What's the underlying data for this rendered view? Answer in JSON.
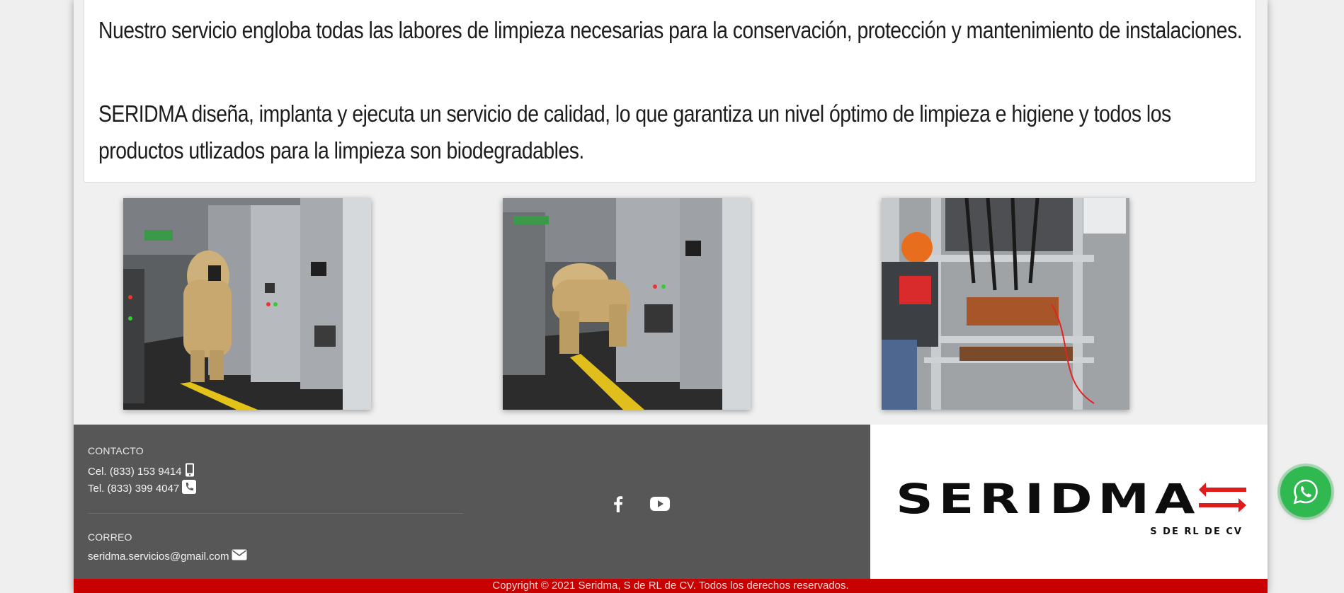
{
  "intro": {
    "paragraph1": "Nuestro servicio engloba todas las labores de limpieza necesarias para la conservación, protección y mantenimiento de instalaciones.",
    "paragraph2": "SERIDMA diseña, implanta y ejecuta un servicio de calidad, lo que garantiza un nivel óptimo de limpieza e higiene y todos los productos utlizados para la limpieza son biodegradables."
  },
  "gallery": [
    {
      "name": "gallery-photo-arc-flash-suit-1",
      "alt": ""
    },
    {
      "name": "gallery-photo-arc-flash-suit-2",
      "alt": ""
    },
    {
      "name": "gallery-photo-electrical-panel",
      "alt": ""
    }
  ],
  "footer": {
    "contact_heading": "CONTACTO",
    "cel": "Cel. (833) 153 9414",
    "cel_icon": "mobile-phone-icon",
    "tel": "Tel. (833) 399 4047",
    "tel_icon": "phone-icon",
    "email_heading": "CORREO",
    "email": "seridma.servicios@gmail.com",
    "email_icon": "envelope-icon",
    "social": [
      {
        "icon": "facebook-icon"
      },
      {
        "icon": "youtube-icon"
      }
    ],
    "logo_text": "SERIDMA",
    "logo_subtext": "S DE RL DE CV",
    "copyright": "Copyright © 2021 Seridma, S de RL de CV. Todos los derechos reservados."
  },
  "colors": {
    "footer_dark": "#575757",
    "copyright_bar": "#c80000",
    "logo_accent": "#e01b1b",
    "whatsapp": "#2fb950"
  },
  "floating": {
    "whatsapp_icon": "whatsapp-icon"
  }
}
